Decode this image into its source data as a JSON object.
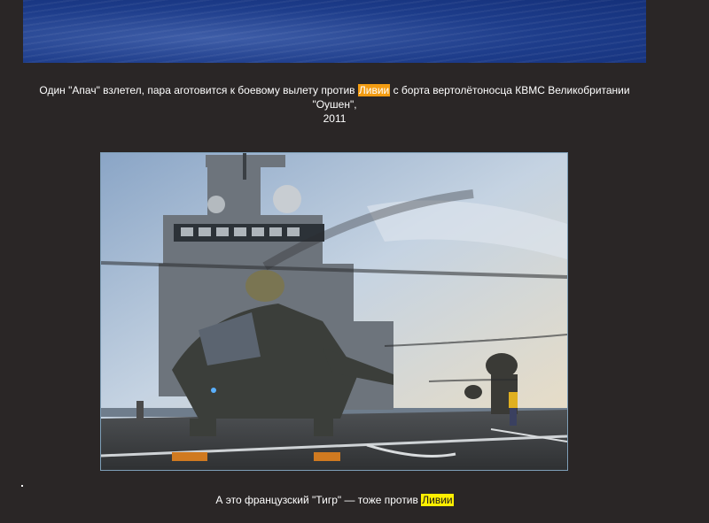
{
  "caption_top": {
    "before": "Один \"Апач\" взлетел, пара аготовится к боевому вылету против ",
    "highlight": "Ливии",
    "after": " с борта вертолётоносца КВМС Великобритании \"Оушен\",",
    "line2": "2011"
  },
  "caption_bottom": {
    "before": "А это французский \"Тигр\" — тоже против ",
    "highlight": "Ливии"
  },
  "colors": {
    "page_background": "#2a2626",
    "highlight_orange": "#f39c12",
    "highlight_yellow": "#ffef00"
  }
}
